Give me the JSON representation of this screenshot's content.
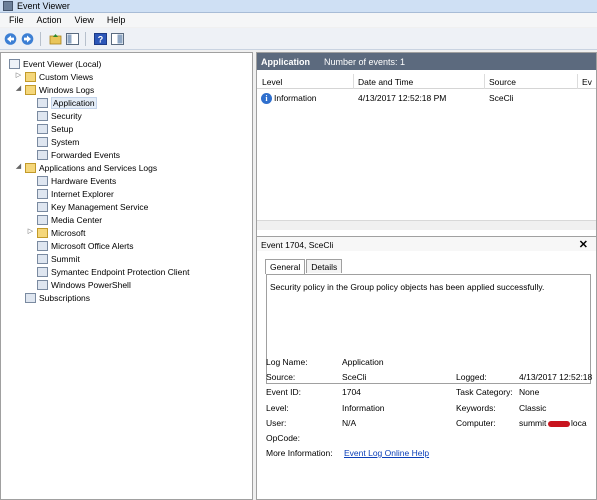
{
  "window": {
    "title": "Event Viewer"
  },
  "menu": [
    "File",
    "Action",
    "View",
    "Help"
  ],
  "tree": {
    "root": "Event Viewer (Local)",
    "custom_views": "Custom Views",
    "windows_logs": "Windows Logs",
    "windows_logs_items": [
      "Application",
      "Security",
      "Setup",
      "System",
      "Forwarded Events"
    ],
    "apps_services": "Applications and Services Logs",
    "apps_services_items": [
      "Hardware Events",
      "Internet Explorer",
      "Key Management Service",
      "Media Center",
      "Microsoft",
      "Microsoft Office Alerts",
      "Summit",
      "Symantec Endpoint Protection Client",
      "Windows PowerShell"
    ],
    "subscriptions": "Subscriptions"
  },
  "log_header": {
    "name": "Application",
    "count": "Number of events: 1"
  },
  "grid": {
    "columns": [
      "Level",
      "Date and Time",
      "Source",
      "Ev"
    ],
    "rows": [
      {
        "level": "Information",
        "datetime": "4/13/2017 12:52:18 PM",
        "source": "SceCli"
      }
    ]
  },
  "detail": {
    "title": "Event 1704, SceCli",
    "tabs": [
      "General",
      "Details"
    ],
    "message": "Security policy in the Group policy objects has been applied successfully.",
    "labels": {
      "log_name": "Log Name:",
      "source": "Source:",
      "event_id": "Event ID:",
      "level": "Level:",
      "user": "User:",
      "opcode": "OpCode:",
      "more_info": "More Information:",
      "logged": "Logged:",
      "task_category": "Task Category:",
      "keywords": "Keywords:",
      "computer": "Computer:"
    },
    "values": {
      "log_name": "Application",
      "source": "SceCli",
      "event_id": "1704",
      "level": "Information",
      "user": "N/A",
      "more_info_link": "Event Log Online Help",
      "logged": "4/13/2017 12:52:18",
      "task_category": "None",
      "keywords": "Classic",
      "computer_start": "summit",
      "computer_end": "loca"
    }
  },
  "colors": {
    "log_header_bg": "#5c6a7e",
    "link": "#0b3fb8",
    "selection": "#e4edf8",
    "redaction": "#c8141e"
  },
  "icons": [
    "back-arrow-icon",
    "forward-arrow-icon",
    "up-folder-icon",
    "show-hide-tree-icon",
    "help-icon",
    "properties-icon",
    "info-icon",
    "close-icon"
  ]
}
